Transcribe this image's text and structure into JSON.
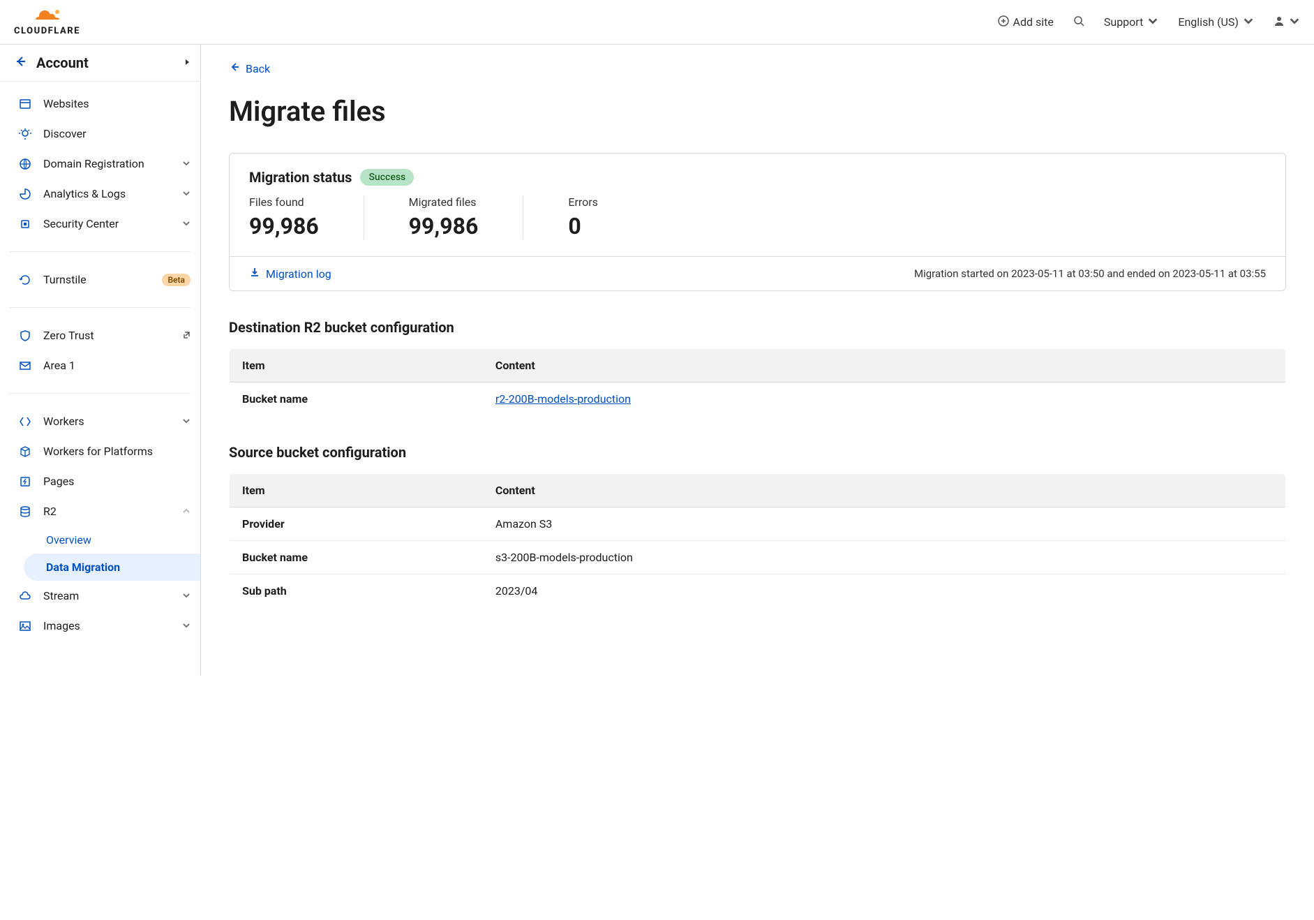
{
  "header": {
    "brand": "CLOUDFLARE",
    "add_site": "Add site",
    "support": "Support",
    "language": "English (US)"
  },
  "sidebar": {
    "account_label": "Account",
    "items": [
      {
        "icon": "window",
        "label": "Websites",
        "chev": false
      },
      {
        "icon": "bulb",
        "label": "Discover",
        "chev": false
      },
      {
        "icon": "globe",
        "label": "Domain Registration",
        "chev": true
      },
      {
        "icon": "pie",
        "label": "Analytics & Logs",
        "chev": true
      },
      {
        "icon": "chip",
        "label": "Security Center",
        "chev": true
      }
    ],
    "items2": [
      {
        "icon": "refresh",
        "label": "Turnstile",
        "beta": "Beta"
      }
    ],
    "items3": [
      {
        "icon": "shield",
        "label": "Zero Trust",
        "ext": true
      },
      {
        "icon": "mail",
        "label": "Area 1"
      }
    ],
    "items4": [
      {
        "icon": "brackets",
        "label": "Workers",
        "chev": true
      },
      {
        "icon": "cube",
        "label": "Workers for Platforms"
      },
      {
        "icon": "bolt",
        "label": "Pages"
      },
      {
        "icon": "db",
        "label": "R2",
        "chev": true,
        "expanded": true,
        "subs": [
          {
            "label": "Overview",
            "active": false
          },
          {
            "label": "Data Migration",
            "active": true
          }
        ]
      },
      {
        "icon": "cloud",
        "label": "Stream",
        "chev": true
      },
      {
        "icon": "image",
        "label": "Images",
        "chev": true
      }
    ]
  },
  "main": {
    "back": "Back",
    "title": "Migrate files",
    "status": {
      "title": "Migration status",
      "badge": "Success",
      "stats": [
        {
          "label": "Files found",
          "value": "99,986"
        },
        {
          "label": "Migrated files",
          "value": "99,986"
        },
        {
          "label": "Errors",
          "value": "0"
        }
      ],
      "log_link": "Migration log",
      "timing": "Migration started on 2023-05-11 at 03:50 and ended on 2023-05-11 at 03:55"
    },
    "dest_title": "Destination R2 bucket configuration",
    "table_headers": {
      "item": "Item",
      "content": "Content"
    },
    "dest_rows": [
      {
        "item": "Bucket name",
        "content": "r2-200B-models-production",
        "link": true
      }
    ],
    "src_title": "Source bucket configuration",
    "src_rows": [
      {
        "item": "Provider",
        "content": "Amazon S3"
      },
      {
        "item": "Bucket name",
        "content": "s3-200B-models-production"
      },
      {
        "item": "Sub path",
        "content": "2023/04"
      }
    ]
  }
}
